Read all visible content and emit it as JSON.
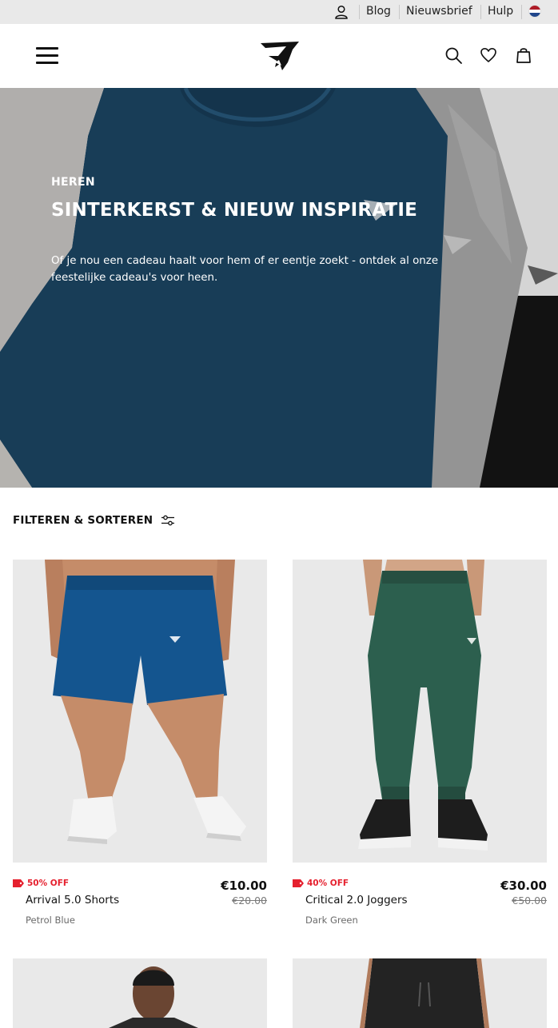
{
  "utility": {
    "links": [
      "Blog",
      "Nieuwsbrief",
      "Hulp"
    ],
    "flag_colors": [
      "#ae1c28",
      "#ffffff",
      "#21468b"
    ]
  },
  "header": {
    "icons": [
      "menu-icon",
      "logo",
      "search-icon",
      "heart-icon",
      "bag-icon"
    ]
  },
  "hero": {
    "eyebrow": "HEREN",
    "title": "SINTERKERST & NIEUW INSPIRATIE",
    "description": "Of je nou een cadeau haalt voor hem of er eentje zoekt - ontdek al onze feestelijke cadeau's voor heen."
  },
  "filter": {
    "label": "FILTEREN & SORTEREN"
  },
  "products": [
    {
      "badge": "50% OFF",
      "name": "Arrival 5.0 Shorts",
      "color": "Petrol Blue",
      "price": "€10.00",
      "old_price": "€20.00"
    },
    {
      "badge": "40% OFF",
      "name": "Critical 2.0 Joggers",
      "color": "Dark Green",
      "price": "€30.00",
      "old_price": "€50.00"
    }
  ],
  "colors": {
    "sale_red": "#e5202e",
    "hero_shirt": "#1c4664",
    "shorts_blue": "#14558f",
    "joggers_green": "#2c5f4e"
  }
}
